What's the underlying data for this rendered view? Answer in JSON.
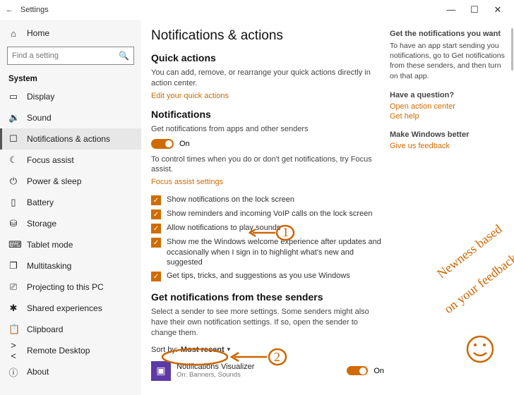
{
  "titlebar": {
    "back": "←",
    "title": "Settings"
  },
  "win_controls": {
    "min": "—",
    "max": "☐",
    "close": "✕"
  },
  "sidebar": {
    "home_label": "Home",
    "search_placeholder": "Find a setting",
    "section": "System",
    "items": [
      {
        "icon": "▭",
        "label": "Display"
      },
      {
        "icon": "🔉",
        "label": "Sound"
      },
      {
        "icon": "☐",
        "label": "Notifications & actions"
      },
      {
        "icon": "☾",
        "label": "Focus assist"
      },
      {
        "icon": "⏻",
        "label": "Power & sleep"
      },
      {
        "icon": "▯",
        "label": "Battery"
      },
      {
        "icon": "⛁",
        "label": "Storage"
      },
      {
        "icon": "⌨",
        "label": "Tablet mode"
      },
      {
        "icon": "❐",
        "label": "Multitasking"
      },
      {
        "icon": "⎚",
        "label": "Projecting to this PC"
      },
      {
        "icon": "✱",
        "label": "Shared experiences"
      },
      {
        "icon": "📋",
        "label": "Clipboard"
      },
      {
        "icon": "><",
        "label": "Remote Desktop"
      },
      {
        "icon": "ⓘ",
        "label": "About"
      }
    ]
  },
  "main": {
    "title": "Notifications & actions",
    "qa_head": "Quick actions",
    "qa_text": "You can add, remove, or rearrange your quick actions directly in action center.",
    "qa_link": "Edit your quick actions",
    "notif_head": "Notifications",
    "notif_toggle_label": "Get notifications from apps and other senders",
    "on_label": "On",
    "focus_text": "To control times when you do or don't get notifications, try Focus assist.",
    "focus_link": "Focus assist settings",
    "checks": [
      "Show notifications on the lock screen",
      "Show reminders and incoming VoIP calls on the lock screen",
      "Allow notifications to play sounds",
      "Show me the Windows welcome experience after updates and occasionally when I sign in to highlight what's new and suggested",
      "Get tips, tricks, and suggestions as you use Windows"
    ],
    "senders_head": "Get notifications from these senders",
    "senders_text": "Select a sender to see more settings. Some senders might also have their own notification settings. If so, open the sender to change them.",
    "sort_label": "Sort by:",
    "sort_value": "Most recent",
    "sender": {
      "name": "Notifications Visualizer",
      "detail": "On: Banners, Sounds",
      "state": "On"
    }
  },
  "aux": {
    "t1": "Get the notifications you want",
    "p1": "To have an app start sending you notifications, go to Get notifications from these senders, and then turn on that app.",
    "t2": "Have a question?",
    "l1": "Open action center",
    "l2": "Get help",
    "t3": "Make Windows better",
    "l3": "Give us feedback"
  },
  "annot": {
    "text1": "Newness based",
    "text2": "on your feedback",
    "n1": "1",
    "n2": "2"
  }
}
